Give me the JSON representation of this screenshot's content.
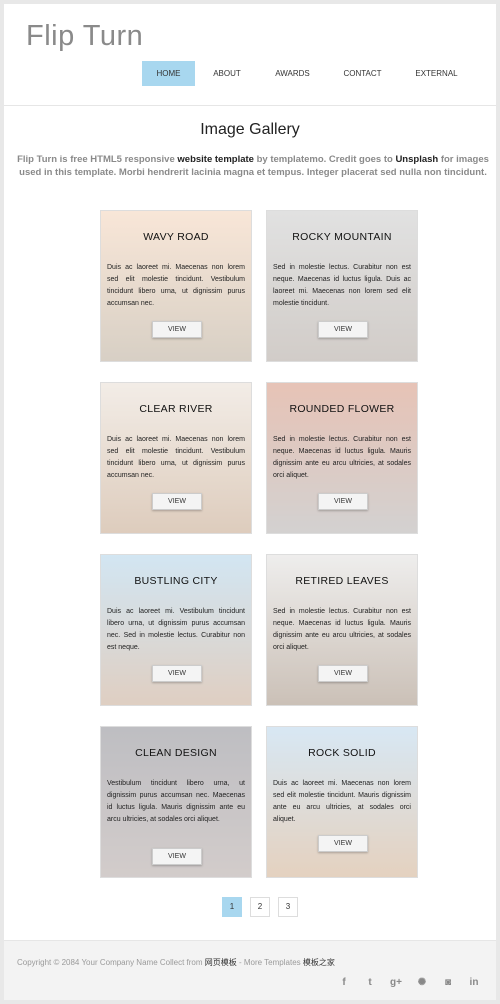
{
  "site": {
    "logo": "Flip Turn"
  },
  "nav": [
    "HOME",
    "ABOUT",
    "AWARDS",
    "CONTACT",
    "EXTERNAL"
  ],
  "gallery": {
    "title": "Image Gallery",
    "intro": {
      "p1": "Flip Turn is free HTML5 responsive ",
      "link1": "website template",
      "p2": " by templatemo. Credit goes to ",
      "link2": "Unsplash",
      "p3": " for images used in this template. Morbi hendrerit lacinia magna et tempus. Integer placerat sed nulla non tincidunt."
    },
    "cards": [
      {
        "title": "WAVY ROAD",
        "desc": "Duis ac laoreet mi. Maecenas non lorem sed elit molestie tincidunt. Vestibulum tincidunt libero urna, ut dignissim purus accumsan nec.",
        "button": "VIEW",
        "colors": [
          "#f0c8a8",
          "#a8967e"
        ]
      },
      {
        "title": "ROCKY MOUNTAIN",
        "desc": "Sed in molestie lectus. Curabitur non est neque. Maecenas id luctus ligula. Duis ac laoreet mi. Maecenas non lorem sed elit molestie tincidunt.",
        "button": "VIEW",
        "colors": [
          "#bdbdbd",
          "#9a8f86"
        ]
      },
      {
        "title": "CLEAR RIVER",
        "desc": "Duis ac laoreet mi. Maecenas non lorem sed elit molestie tincidunt. Vestibulum tincidunt libero urna, ut dignissim purus accumsan nec.",
        "button": "VIEW",
        "colors": [
          "#e3d6c9",
          "#b58f6d"
        ]
      },
      {
        "title": "ROUNDED FLOWER",
        "desc": "Sed in molestie lectus. Curabitur non est neque. Maecenas id luctus ligula. Mauris dignissim ante eu arcu ultricies, at sodales orci aliquet.",
        "button": "VIEW",
        "colors": [
          "#c97a5e",
          "#9e9a98"
        ]
      },
      {
        "title": "BUSTLING CITY",
        "desc": "Duis ac laoreet mi. Vestibulum tincidunt libero urna, ut dignissim purus accumsan nec. Sed in molestie lectus. Curabitur non est neque.",
        "button": "VIEW",
        "colors": [
          "#9cc7e3",
          "#b89478"
        ]
      },
      {
        "title": "RETIRED LEAVES",
        "desc": "Sed in molestie lectus. Curabitur non est neque. Maecenas id luctus ligula. Mauris dignissim ante eu arcu ultricies, at sodales orci aliquet.",
        "button": "VIEW",
        "colors": [
          "#dad8d6",
          "#8c7560"
        ]
      },
      {
        "title": "CLEAN DESIGN",
        "desc": "Vestibulum tincidunt libero urna, ut dignissim purus accumsan nec. Maecenas id luctus ligula. Mauris dignissim ante eu arcu ultricies, at sodales orci aliquet.",
        "button": "VIEW",
        "colors": [
          "#6f6f78",
          "#9d8f8c"
        ]
      },
      {
        "title": "ROCK SOLID",
        "desc": "Duis ac laoreet mi. Maecenas non lorem sed elit molestie tincidunt. Mauris dignissim ante eu arcu ultricies, at sodales orci aliquet.",
        "button": "VIEW",
        "colors": [
          "#a8cbe6",
          "#c49a72"
        ]
      }
    ]
  },
  "pagination": [
    "1",
    "2",
    "3"
  ],
  "footer": {
    "text": "Copyright © 2084 Your Company Name Collect from ",
    "link1": "网页模板",
    "text2": " - More Templates ",
    "link2": "模板之家"
  },
  "social": [
    {
      "name": "facebook-icon",
      "glyph": "f"
    },
    {
      "name": "twitter-icon",
      "glyph": "t"
    },
    {
      "name": "google-plus-icon",
      "glyph": "g+"
    },
    {
      "name": "dribbble-icon",
      "glyph": "✺"
    },
    {
      "name": "instagram-icon",
      "glyph": "◙"
    },
    {
      "name": "linkedin-icon",
      "glyph": "in"
    }
  ],
  "theme": {
    "accent": "#a8d7ef"
  }
}
